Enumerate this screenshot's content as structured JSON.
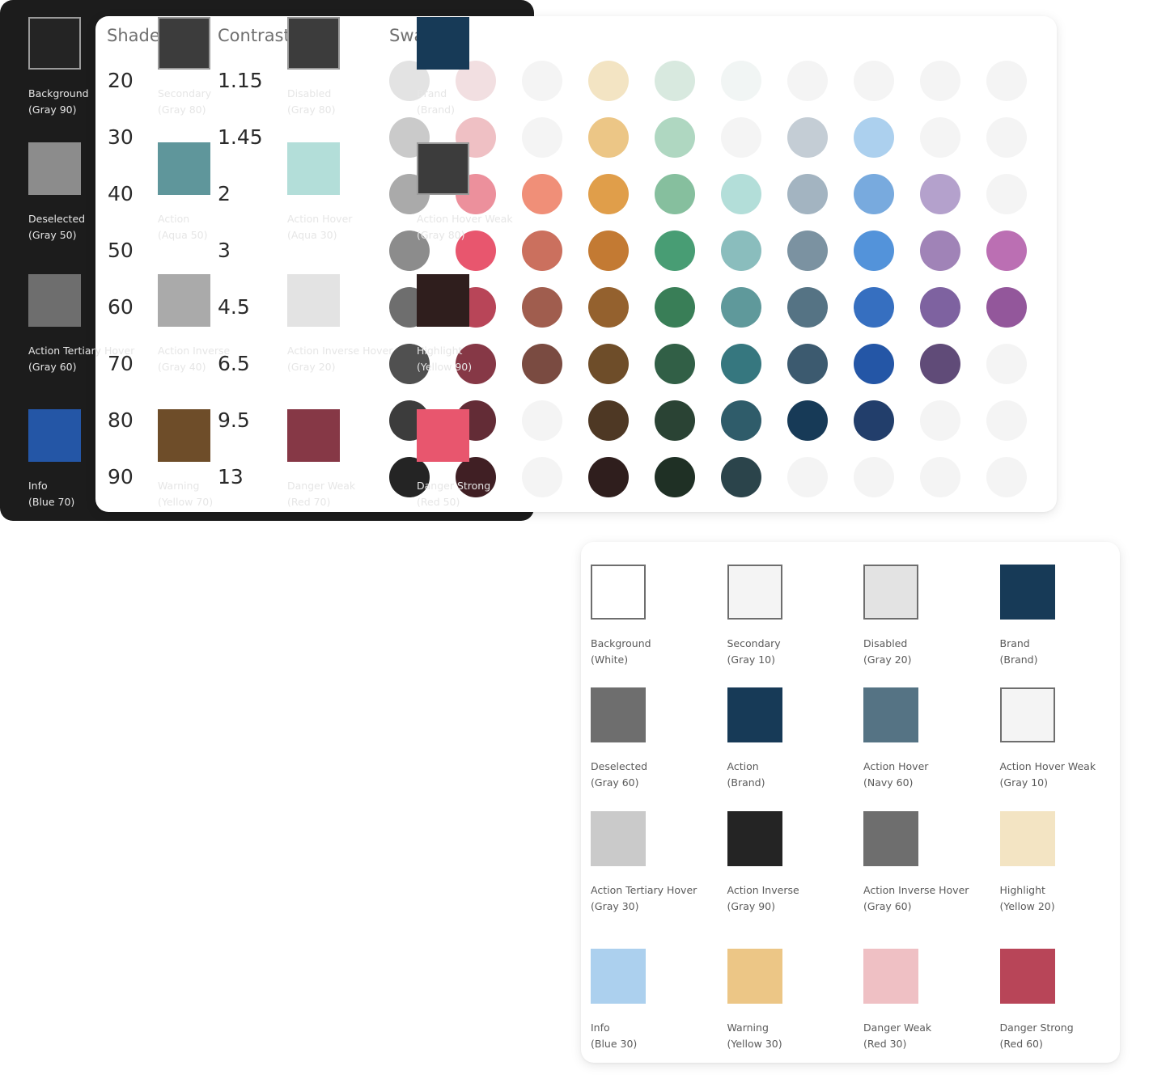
{
  "shade_table": {
    "headers": {
      "shade": "Shade",
      "contrast": "Contrast Ratio",
      "swatch": "Swatch"
    },
    "rows": [
      {
        "shade": "20",
        "ratio": "1.15",
        "colors": [
          "#e3e3e3",
          "#f2dfe1",
          "#f4f4f4",
          "#f3e4c3",
          "#d8e9df",
          "#f1f5f4",
          "#f4f4f4",
          "#f4f4f4",
          "#f4f4f4",
          "#f4f4f4"
        ]
      },
      {
        "shade": "30",
        "ratio": "1.45",
        "colors": [
          "#cacaca",
          "#efc0c4",
          "#f4f4f4",
          "#ecc686",
          "#afd7c1",
          "#f4f4f4",
          "#c4cdd5",
          "#acd0ee",
          "#f4f4f4",
          "#f4f4f4"
        ]
      },
      {
        "shade": "40",
        "ratio": "2",
        "colors": [
          "#aaaaaa",
          "#ec909c",
          "#f08f78",
          "#e09e4a",
          "#86bf9e",
          "#b3ded9",
          "#a3b4c1",
          "#78aade",
          "#b4a1cc",
          "#f4f4f4"
        ]
      },
      {
        "shade": "50",
        "ratio": "3",
        "colors": [
          "#8c8c8c",
          "#e8566e",
          "#cb705e",
          "#c37a33",
          "#489d74",
          "#8abdbd",
          "#7b92a1",
          "#5393da",
          "#a083b7",
          "#bb6fb3"
        ]
      },
      {
        "shade": "60",
        "ratio": "4.5",
        "colors": [
          "#6e6e6e",
          "#b84558",
          "#a05d4e",
          "#94612e",
          "#397e57",
          "#5f999b",
          "#557384",
          "#366fc0",
          "#7e62a0",
          "#93579b"
        ]
      },
      {
        "shade": "70",
        "ratio": "6.5",
        "colors": [
          "#505050",
          "#863846",
          "#7a4b41",
          "#6e4d29",
          "#315f46",
          "#36777f",
          "#3c5a6f",
          "#2456a6",
          "#604b78",
          "#f4f4f4"
        ]
      },
      {
        "shade": "80",
        "ratio": "9.5",
        "colors": [
          "#3c3c3c",
          "#632c36",
          "#f4f4f4",
          "#4e3824",
          "#2a4334",
          "#2f5c6a",
          "#173a57",
          "#223e6b",
          "#f4f4f4",
          "#f4f4f4"
        ]
      },
      {
        "shade": "90",
        "ratio": "13",
        "colors": [
          "#242424",
          "#401f24",
          "#f4f4f4",
          "#2f1e1d",
          "#1f3025",
          "#2b444b",
          "#f4f4f4",
          "#f4f4f4",
          "#f4f4f4",
          "#f4f4f4"
        ]
      }
    ]
  },
  "dark_theme": {
    "swatches": [
      {
        "name": "Background",
        "token": "(Gray 90)",
        "color": "#242424",
        "outline": true
      },
      {
        "name": "Secondary",
        "token": "(Gray 80)",
        "color": "#3c3c3c",
        "outline": true
      },
      {
        "name": "Disabled",
        "token": "(Gray 80)",
        "color": "#3c3c3c",
        "outline": true
      },
      {
        "name": "Brand",
        "token": "(Brand)",
        "color": "#173a57",
        "outline": false
      },
      {
        "name": "Deselected",
        "token": "(Gray 50)",
        "color": "#8c8c8c",
        "outline": false
      },
      {
        "name": "Action",
        "token": "(Aqua 50)",
        "color": "#5f969b",
        "outline": false
      },
      {
        "name": "Action Hover",
        "token": "(Aqua 30)",
        "color": "#b3ded9",
        "outline": false
      },
      {
        "name": "Action Hover Weak",
        "token": "(Gray 80)",
        "color": "#3c3c3c",
        "outline": true
      },
      {
        "name": "Action Tertiary Hover",
        "token": "(Gray 60)",
        "color": "#6e6e6e",
        "outline": false
      },
      {
        "name": "Action Inverse",
        "token": "(Gray 40)",
        "color": "#aaaaaa",
        "outline": false
      },
      {
        "name": "Action Inverse Hover",
        "token": "(Gray 20)",
        "color": "#e3e3e3",
        "outline": false
      },
      {
        "name": "Highlight",
        "token": "(Yellow 90)",
        "color": "#2f1e1d",
        "outline": false
      },
      {
        "name": "Info",
        "token": "(Blue 70)",
        "color": "#2456a6",
        "outline": false
      },
      {
        "name": "Warning",
        "token": "(Yellow 70)",
        "color": "#6e4d29",
        "outline": false
      },
      {
        "name": "Danger Weak",
        "token": "(Red 70)",
        "color": "#863846",
        "outline": false
      },
      {
        "name": "Danger Strong",
        "token": "(Red 50)",
        "color": "#e8566e",
        "outline": false
      }
    ]
  },
  "light_theme": {
    "swatches": [
      {
        "name": "Background",
        "token": "(White)",
        "color": "#ffffff",
        "outline": true
      },
      {
        "name": "Secondary",
        "token": "(Gray 10)",
        "color": "#f4f4f4",
        "outline": true
      },
      {
        "name": "Disabled",
        "token": "(Gray 20)",
        "color": "#e3e3e3",
        "outline": true
      },
      {
        "name": "Brand",
        "token": "(Brand)",
        "color": "#173a57",
        "outline": false
      },
      {
        "name": "Deselected",
        "token": "(Gray 60)",
        "color": "#6e6e6e",
        "outline": false
      },
      {
        "name": "Action",
        "token": "(Brand)",
        "color": "#173a57",
        "outline": false
      },
      {
        "name": "Action Hover",
        "token": "(Navy 60)",
        "color": "#557384",
        "outline": false
      },
      {
        "name": "Action Hover Weak",
        "token": "(Gray 10)",
        "color": "#f4f4f4",
        "outline": true
      },
      {
        "name": "Action Tertiary Hover",
        "token": "(Gray 30)",
        "color": "#cacaca",
        "outline": false
      },
      {
        "name": "Action Inverse",
        "token": "(Gray 90)",
        "color": "#242424",
        "outline": false
      },
      {
        "name": "Action Inverse Hover",
        "token": "(Gray 60)",
        "color": "#6e6e6e",
        "outline": false
      },
      {
        "name": "Highlight",
        "token": "(Yellow 20)",
        "color": "#f3e4c3",
        "outline": false
      },
      {
        "name": "Info",
        "token": "(Blue 30)",
        "color": "#acd0ee",
        "outline": false
      },
      {
        "name": "Warning",
        "token": "(Yellow 30)",
        "color": "#ecc686",
        "outline": false
      },
      {
        "name": "Danger Weak",
        "token": "(Red 30)",
        "color": "#efc0c4",
        "outline": false
      },
      {
        "name": "Danger Strong",
        "token": "(Red 60)",
        "color": "#b84558",
        "outline": false
      }
    ]
  }
}
